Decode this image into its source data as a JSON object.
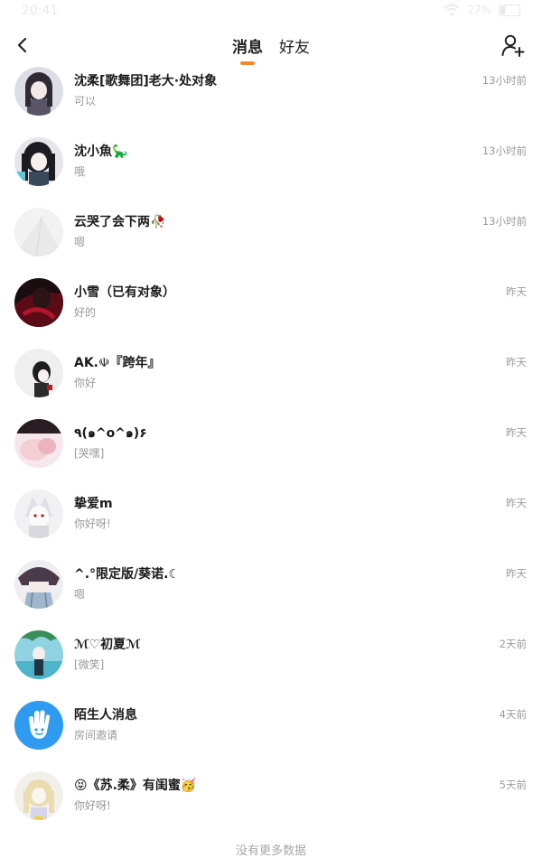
{
  "status": {
    "time": "20:41",
    "battery": "27%"
  },
  "header": {
    "tabs": [
      {
        "label": "消息",
        "active": true
      },
      {
        "label": "好友",
        "active": false
      }
    ]
  },
  "conversations": [
    {
      "name": "沈柔[歌舞团]老大·处对象",
      "message": "可以",
      "time": "13小时前",
      "avatar": "avatar-anime-girl-dark-hair"
    },
    {
      "name": "沈小魚🦕",
      "message": "哦",
      "time": "13小时前",
      "avatar": "avatar-anime-girl-black-hair"
    },
    {
      "name": "云哭了会下两🥀",
      "message": "嗯",
      "time": "13小时前",
      "avatar": "avatar-white-paper"
    },
    {
      "name": "小雪（已有对象）",
      "message": "好的",
      "time": "昨天",
      "avatar": "avatar-dark-red-figure"
    },
    {
      "name": "AK.☫『跨年』",
      "message": "你好",
      "time": "昨天",
      "avatar": "avatar-anime-girl-bw"
    },
    {
      "name": "٩(๑^o^๑)۶",
      "message": "[哭嘿]",
      "time": "昨天",
      "avatar": "avatar-anime-hands-pink"
    },
    {
      "name": "挚爱m",
      "message": "你好呀!",
      "time": "昨天",
      "avatar": "avatar-anime-white-hair"
    },
    {
      "name": "^.°限定版/葵诺.☾",
      "message": "嗯",
      "time": "昨天",
      "avatar": "avatar-anime-girl-skirt"
    },
    {
      "name": "ℳ♡初夏ℳ",
      "message": "[微笑]",
      "time": "2天前",
      "avatar": "avatar-anime-beach"
    },
    {
      "name": "陌生人消息",
      "message": "房间邀请",
      "time": "4天前",
      "avatar": "hand-wave-icon"
    },
    {
      "name": "😝《苏.柔》有闺蜜🥳",
      "message": "你好呀!",
      "time": "5天前",
      "avatar": "avatar-anime-blonde-girl"
    }
  ],
  "footer": {
    "text": "没有更多数据"
  },
  "colors": {
    "accent": "#f5892a",
    "stranger_avatar": "#2f9bf0",
    "muted_text": "#999999"
  }
}
